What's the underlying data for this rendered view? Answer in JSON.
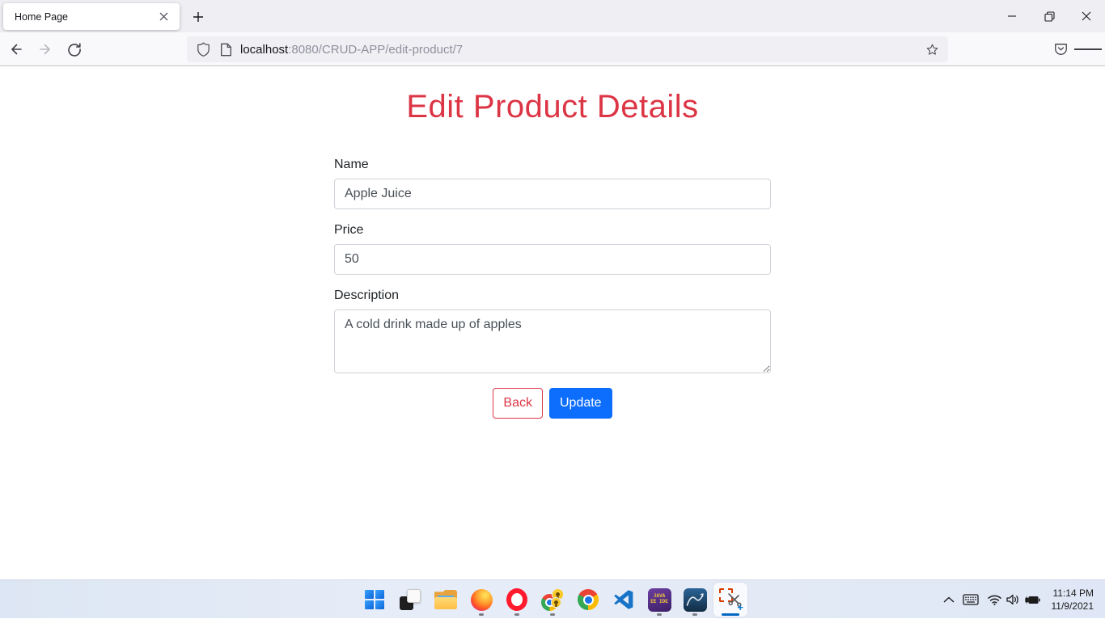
{
  "browser": {
    "tab_title": "Home Page",
    "url_host": "localhost",
    "url_path": ":8080/CRUD-APP/edit-product/7"
  },
  "page": {
    "heading": "Edit Product Details",
    "form": {
      "name": {
        "label": "Name",
        "value": "Apple Juice"
      },
      "price": {
        "label": "Price",
        "value": "50"
      },
      "description": {
        "label": "Description",
        "value": "A cold drink made up of apples"
      },
      "buttons": {
        "back": "Back",
        "update": "Update"
      }
    },
    "colors": {
      "heading_red": "#dc3545",
      "button_blue": "#0d6efd",
      "back_red": "#dc3545"
    }
  },
  "taskbar": {
    "apps": [
      {
        "name": "start",
        "running": false
      },
      {
        "name": "task-view",
        "running": false
      },
      {
        "name": "file-explorer",
        "running": false
      },
      {
        "name": "firefox",
        "running": true
      },
      {
        "name": "opera",
        "running": true
      },
      {
        "name": "chrome-profile",
        "running": true
      },
      {
        "name": "chrome",
        "running": false
      },
      {
        "name": "vscode",
        "running": false
      },
      {
        "name": "eclipse-ide",
        "running": true,
        "badge": "JAVA EE IDE"
      },
      {
        "name": "mysql-workbench",
        "running": true
      },
      {
        "name": "snipping-tool",
        "running": true,
        "active": true
      }
    ],
    "clock": {
      "time": "11:14 PM",
      "date": "11/9/2021"
    }
  }
}
